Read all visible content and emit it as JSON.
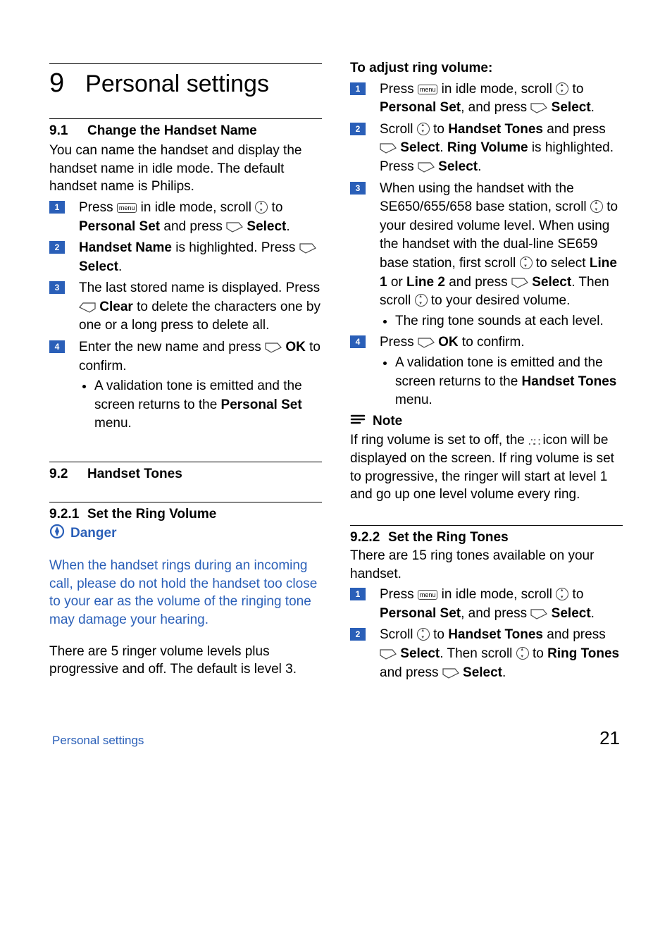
{
  "chapter": {
    "num": "9",
    "title": "Personal settings"
  },
  "s9_1": {
    "num": "9.1",
    "title": "Change the Handset Name",
    "intro": "You can name the handset and display the handset name in idle mode. The default handset name is Philips.",
    "step1_a": "Press ",
    "step1_b": " in idle mode, scroll ",
    "step1_c": " to ",
    "step1_personal": "Personal Set",
    "step1_d": " and press ",
    "step1_select": "Select",
    "step1_period": ".",
    "step2_a": "Handset Name",
    "step2_b": " is highlighted. Press ",
    "step2_select": "Select",
    "step2_period": ".",
    "step3_a": "The last stored name is displayed. Press ",
    "step3_clear": "Clear",
    "step3_b": " to delete the characters one by one or a long press to delete all.",
    "step4_a": "Enter the new name and press ",
    "step4_ok": "OK",
    "step4_b": " to confirm.",
    "step4_bullet_a": "A validation tone is emitted and the screen returns to the ",
    "step4_bullet_b": "Personal Set",
    "step4_bullet_c": " menu."
  },
  "s9_2": {
    "num": "9.2",
    "title": "Handset Tones"
  },
  "s9_2_1": {
    "num": "9.2.1",
    "title": "Set the Ring Volume",
    "danger_label": "Danger",
    "danger_text": "When the handset rings during an incoming call, please do not hold the handset too close to your ear as the volume of the ringing tone may damage your hearing.",
    "body": "There are 5 ringer volume levels plus progressive and off. The default is level 3.",
    "procTitle": "To adjust ring volume:",
    "step1_a": "Press ",
    "step1_b": " in idle mode, scroll ",
    "step1_c": " to ",
    "step1_personal": "Personal Set",
    "step1_d": ", and press ",
    "step1_select": "Select",
    "step1_period": ".",
    "step2_a": "Scroll ",
    "step2_b": " to ",
    "step2_ht": "Handset Tones",
    "step2_c": " and press ",
    "step2_select1": "Select",
    "step2_d": ". ",
    "step2_rv": "Ring Volume",
    "step2_e": " is highlighted. Press ",
    "step2_select2": "Select",
    "step2_period": ".",
    "step3_a": "When using the handset with the SE650/655/658 base station, scroll ",
    "step3_b": " to your desired volume level. When using the handset with the dual-line SE659 base station, first scroll ",
    "step3_c": " to select ",
    "step3_l1": "Line 1",
    "step3_or": " or ",
    "step3_l2": "Line 2",
    "step3_d": " and press ",
    "step3_select": "Select",
    "step3_e": ". Then scroll ",
    "step3_f": " to your desired volume.",
    "step3_bullet": "The ring tone sounds at each level.",
    "step4_a": "Press ",
    "step4_ok": "OK",
    "step4_b": " to confirm.",
    "step4_bullet_a": "A validation tone is emitted and the screen returns to the ",
    "step4_bullet_b": "Handset Tones",
    "step4_bullet_c": " menu.",
    "note_label": "Note",
    "note_text_a": "If ring volume is set to off, the ",
    "note_text_b": " icon will be displayed on the screen. If ring volume is set to progressive, the ringer will start at level 1 and go up one level volume every ring."
  },
  "s9_2_2": {
    "num": "9.2.2",
    "title": "Set the Ring Tones",
    "intro": "There are 15 ring tones available on your handset.",
    "step1_a": "Press ",
    "step1_b": " in idle mode, scroll ",
    "step1_c": " to ",
    "step1_personal": "Personal Set",
    "step1_d": ", and press ",
    "step1_select": "Select",
    "step1_period": ".",
    "step2_a": "Scroll ",
    "step2_b": " to ",
    "step2_ht": "Handset Tones",
    "step2_c": " and press ",
    "step2_select1": "Select",
    "step2_d": ". Then scroll ",
    "step2_e": " to ",
    "step2_rt": "Ring Tones",
    "step2_f": " and press ",
    "step2_select2": "Select",
    "step2_period": "."
  },
  "footer": {
    "section": "Personal settings",
    "page": "21"
  },
  "icons": {
    "menu": "menu"
  }
}
